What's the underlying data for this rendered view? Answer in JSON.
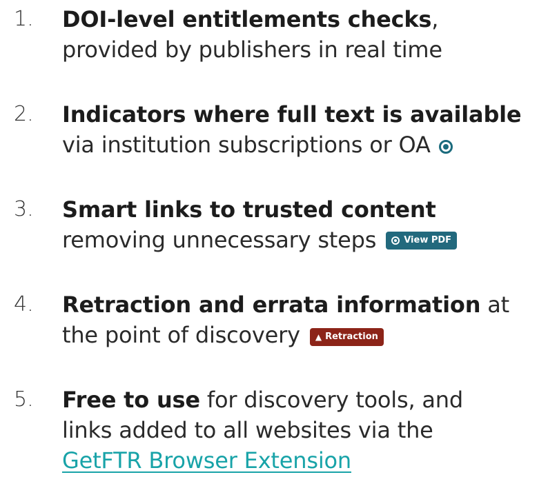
{
  "items": [
    {
      "number": "1.",
      "bold": "DOI-level entitlements checks",
      "after_bold": ",",
      "line2": "provided by publishers in real time"
    },
    {
      "number": "2.",
      "bold": "Indicators where full text is available",
      "line2": "via institution subscriptions or OA",
      "icon": "target-icon"
    },
    {
      "number": "3.",
      "bold": "Smart links to trusted content",
      "line2": "removing unnecessary steps",
      "badge": {
        "label": "View PDF",
        "icon": "target-icon",
        "color": "#22697d"
      }
    },
    {
      "number": "4.",
      "bold": "Retraction and errata information",
      "after_bold": " at",
      "line2": "the point of discovery",
      "badge": {
        "label": "Retraction",
        "icon": "warning-icon",
        "color": "#8c2418"
      }
    },
    {
      "number": "5.",
      "bold": "Free to use",
      "after_bold": " for discovery tools, and",
      "line2": "links added to all websites via the",
      "line3_link": "GetFTR Browser Extension",
      "link_color": "#18a3a8"
    }
  ]
}
